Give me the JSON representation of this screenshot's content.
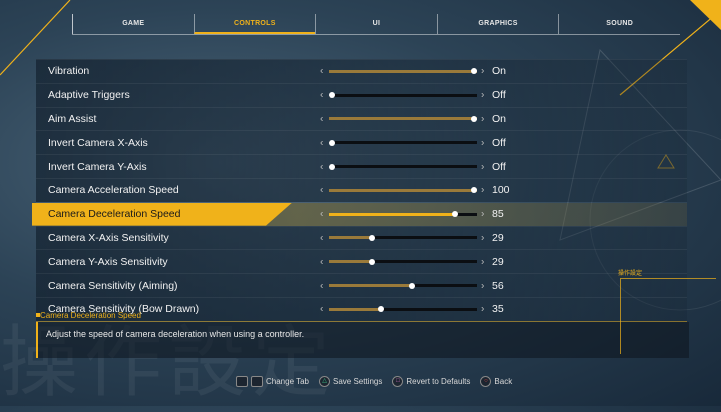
{
  "tabs": [
    {
      "label": "GAME",
      "active": false
    },
    {
      "label": "CONTROLS",
      "active": true
    },
    {
      "label": "UI",
      "active": false
    },
    {
      "label": "GRAPHICS",
      "active": false
    },
    {
      "label": "SOUND",
      "active": false
    }
  ],
  "settings": [
    {
      "label": "Vibration",
      "value": "On",
      "level": 1.0
    },
    {
      "label": "Adaptive Triggers",
      "value": "Off",
      "level": 0.0
    },
    {
      "label": "Aim Assist",
      "value": "On",
      "level": 1.0
    },
    {
      "label": "Invert Camera X-Axis",
      "value": "Off",
      "level": 0.0
    },
    {
      "label": "Invert Camera Y-Axis",
      "value": "Off",
      "level": 0.0
    },
    {
      "label": "Camera Acceleration Speed",
      "value": "100",
      "level": 1.0
    },
    {
      "label": "Camera Deceleration Speed",
      "value": "85",
      "level": 0.85,
      "selected": true
    },
    {
      "label": "Camera X-Axis Sensitivity",
      "value": "29",
      "level": 0.29
    },
    {
      "label": "Camera Y-Axis Sensitivity",
      "value": "29",
      "level": 0.29
    },
    {
      "label": "Camera Sensitivity (Aiming)",
      "value": "56",
      "level": 0.56
    },
    {
      "label": "Camera Sensitivity (Bow Drawn)",
      "value": "35",
      "level": 0.35
    }
  ],
  "description": {
    "title": "Camera Deceleration Speed",
    "text": "Adjust the speed of camera deceleration when using a controller."
  },
  "footer": [
    {
      "icon": "L1-R1",
      "label": "Change Tab"
    },
    {
      "icon": "△",
      "label": "Save Settings"
    },
    {
      "icon": "□",
      "label": "Revert to Defaults"
    },
    {
      "icon": "○",
      "label": "Back"
    }
  ],
  "side_label": "操作設定",
  "background_text": "操作設定",
  "colors": {
    "accent": "#f0b21a",
    "fill_dim": "#9a7a3a"
  }
}
